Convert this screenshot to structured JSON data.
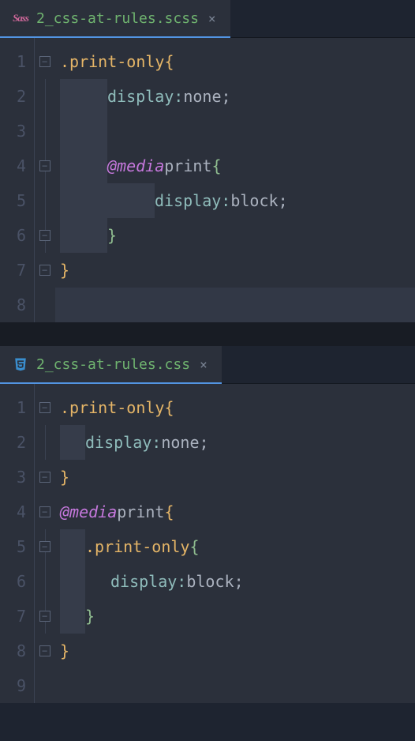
{
  "panes": [
    {
      "tab": {
        "icon": "sass-icon",
        "filename": "2_css-at-rules.scss",
        "close": "×"
      },
      "gutter": [
        "1",
        "2",
        "3",
        "4",
        "5",
        "6",
        "7",
        "8"
      ],
      "fold": [
        "open",
        "",
        "",
        "open",
        "",
        "close",
        "close",
        ""
      ],
      "code": {
        "sel": ".print-only",
        "brace_open": "{",
        "prop_display": "display",
        "colon": ":",
        "val_none": "none",
        "val_block": "block",
        "semi": ";",
        "at_media": "@media",
        "media_val": "print",
        "brace_open_g": "{",
        "brace_close_g": "}",
        "brace_close": "}"
      }
    },
    {
      "tab": {
        "icon": "css-icon",
        "filename": "2_css-at-rules.css",
        "close": "×"
      },
      "gutter": [
        "1",
        "2",
        "3",
        "4",
        "5",
        "6",
        "7",
        "8",
        "9"
      ],
      "fold": [
        "open",
        "",
        "close",
        "open",
        "open",
        "",
        "close",
        "close",
        ""
      ],
      "code": {
        "sel": ".print-only",
        "brace_open": "{",
        "prop_display": "display",
        "colon": ":",
        "val_none": "none",
        "val_block": "block",
        "semi": ";",
        "at_media": "@media",
        "media_val": "print",
        "brace_open_g": "{",
        "brace_close_g": "}",
        "brace_close": "}"
      }
    }
  ]
}
